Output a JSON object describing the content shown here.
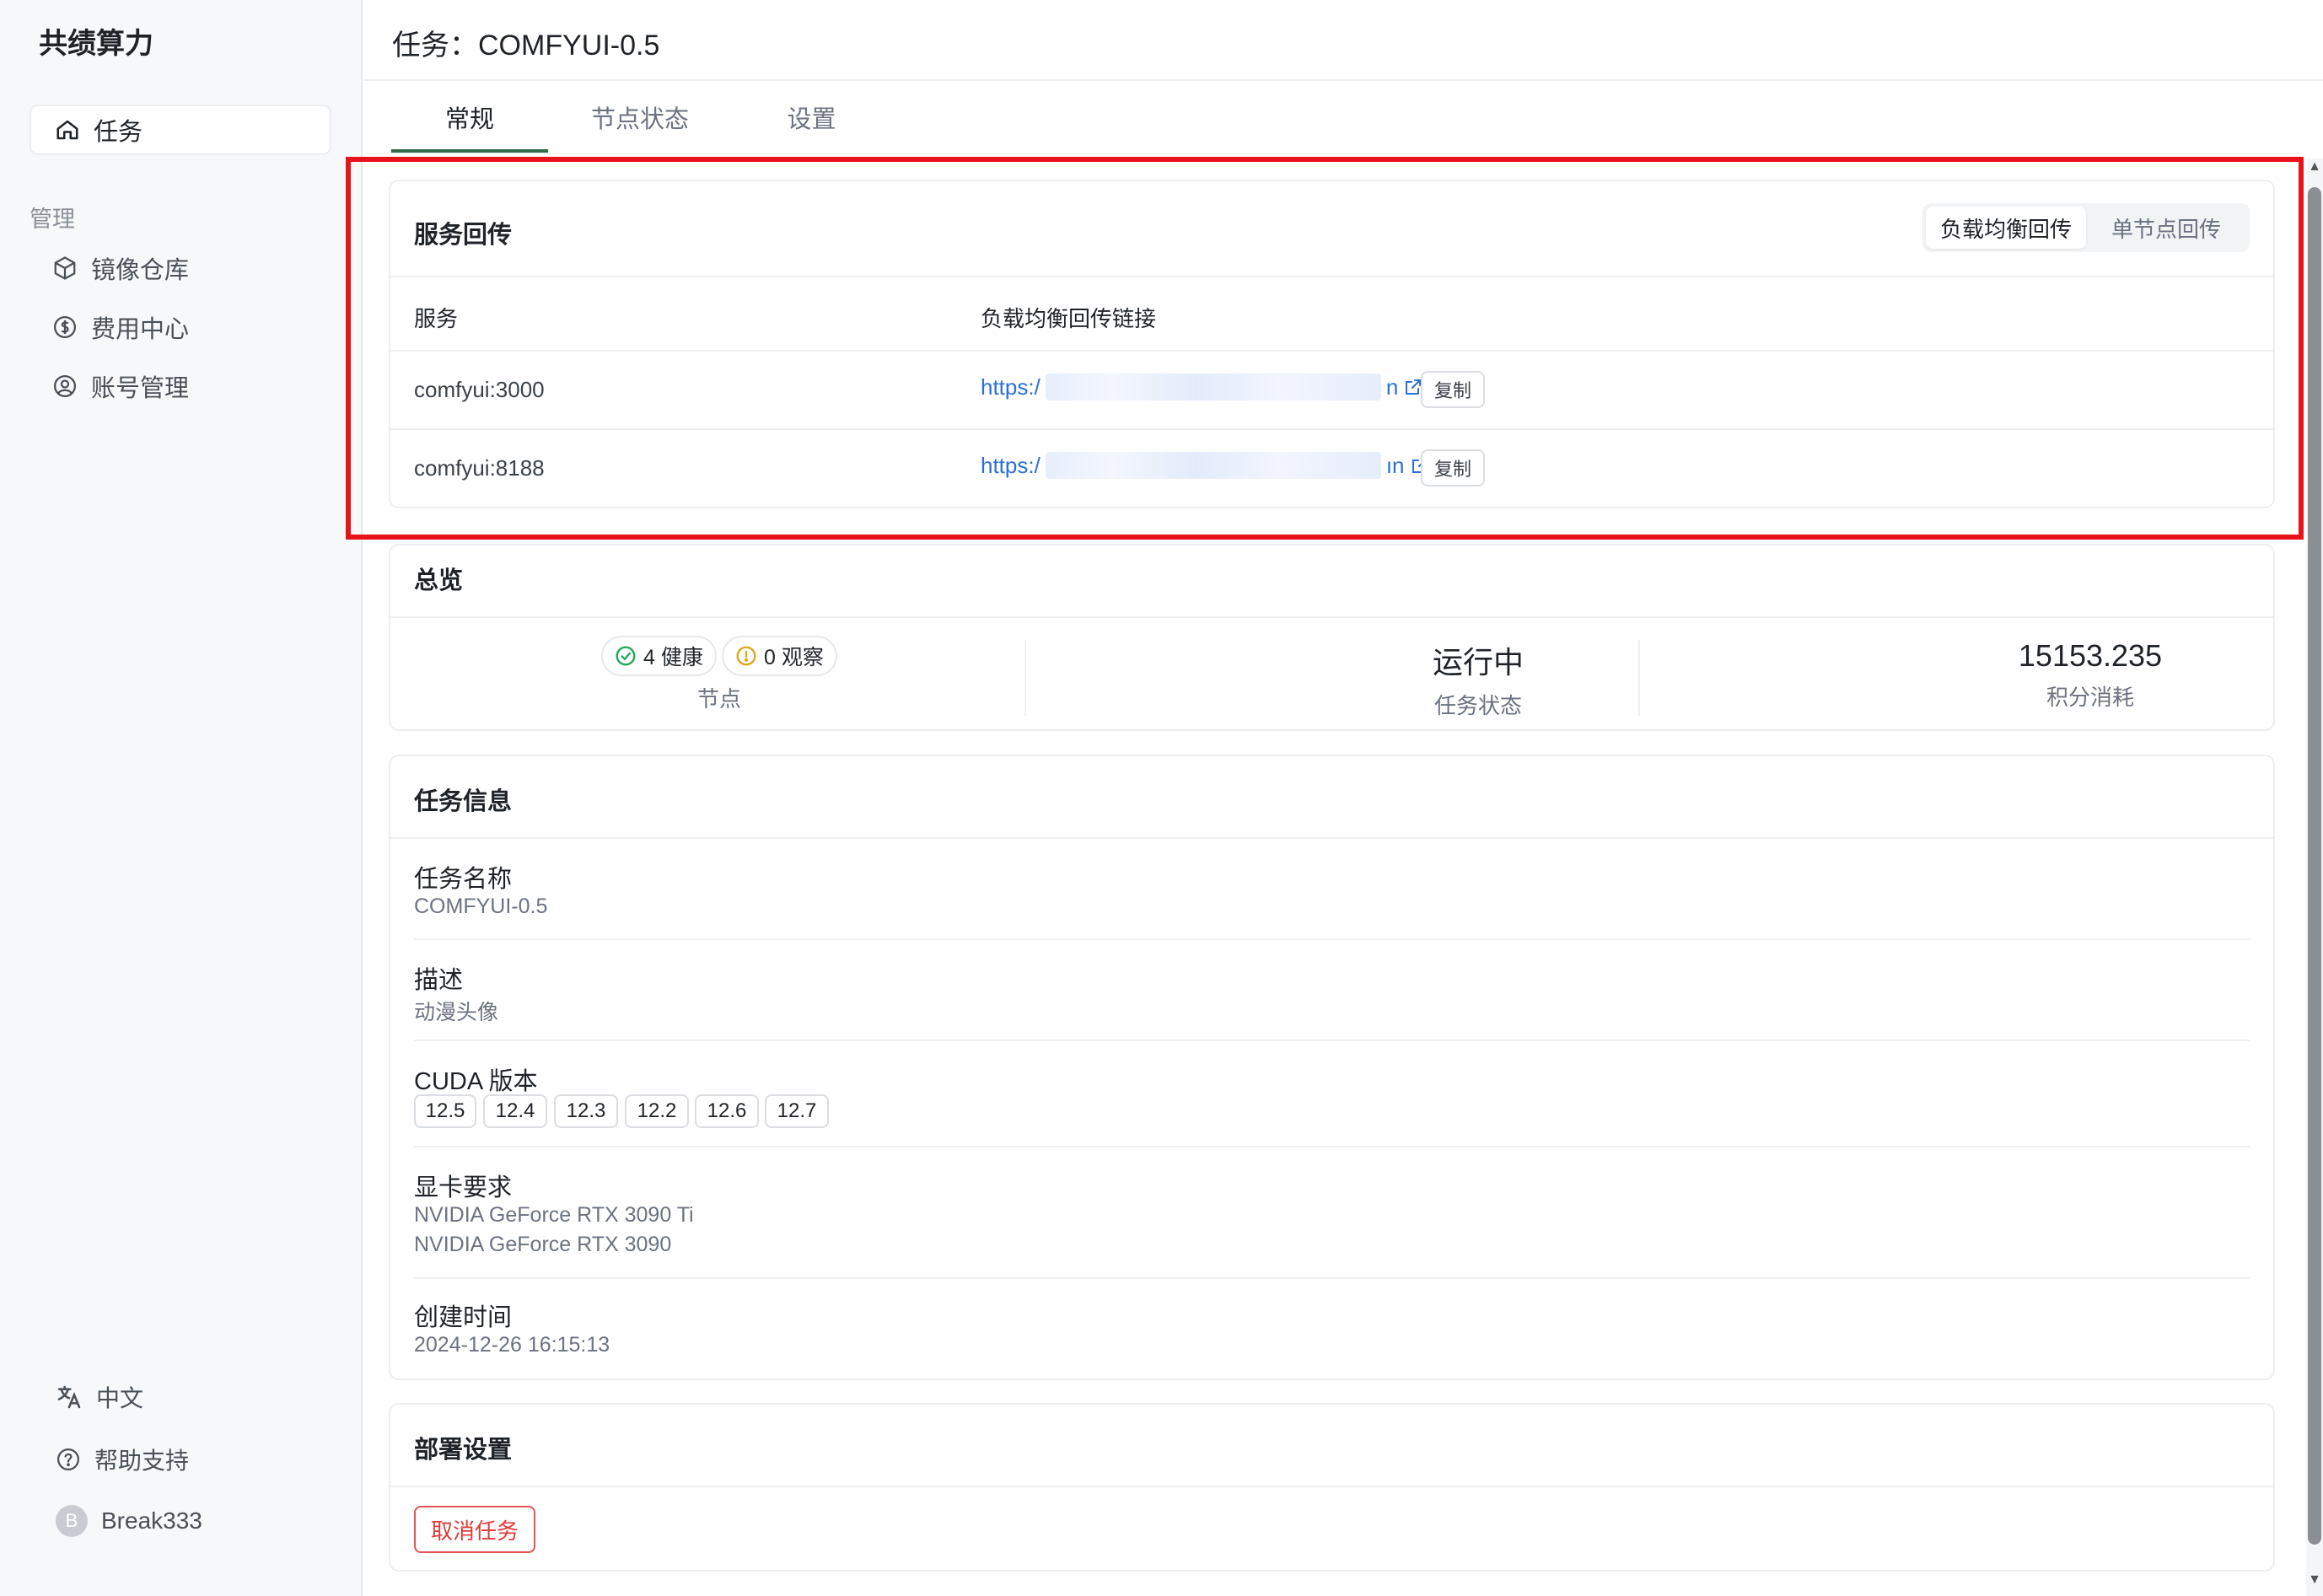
{
  "brand": "共绩算力",
  "sidebar": {
    "active_item": "任务",
    "section_label": "管理",
    "items": [
      {
        "label": "镜像仓库",
        "icon": "cube-icon"
      },
      {
        "label": "费用中心",
        "icon": "dollar-icon"
      },
      {
        "label": "账号管理",
        "icon": "user-circle-icon"
      }
    ],
    "bottom": {
      "language": "中文",
      "help": "帮助支持",
      "user": "Break333",
      "avatar_letter": "B"
    }
  },
  "header": {
    "title": "任务：COMFYUI-0.5",
    "tabs": [
      "常规",
      "节点状态",
      "设置"
    ],
    "active_tab": 0
  },
  "service": {
    "title": "服务回传",
    "toggle": [
      "负载均衡回传",
      "单节点回传"
    ],
    "active_toggle": 0,
    "columns": [
      "服务",
      "负载均衡回传链接"
    ],
    "rows": [
      {
        "service": "comfyui:3000",
        "link_prefix": "https:/",
        "link_suffix": "n",
        "copy": "复制"
      },
      {
        "service": "comfyui:8188",
        "link_prefix": "https:/",
        "link_suffix": "ın",
        "copy": "复制"
      }
    ]
  },
  "overview": {
    "title": "总览",
    "healthy_label": "4 健康",
    "observe_label": "0 观察",
    "nodes_label": "节点",
    "status_value": "运行中",
    "status_label": "任务状态",
    "points_value": "15153.235",
    "points_label": "积分消耗"
  },
  "info": {
    "title": "任务信息",
    "name_label": "任务名称",
    "name_value": "COMFYUI-0.5",
    "desc_label": "描述",
    "desc_value": "动漫头像",
    "cuda_label": "CUDA 版本",
    "cuda_versions": [
      "12.5",
      "12.4",
      "12.3",
      "12.2",
      "12.6",
      "12.7"
    ],
    "gpu_label": "显卡要求",
    "gpus": [
      "NVIDIA GeForce RTX 3090 Ti",
      "NVIDIA GeForce RTX 3090"
    ],
    "created_label": "创建时间",
    "created_value": "2024-12-26 16:15:13"
  },
  "deploy": {
    "title": "部署设置",
    "cancel": "取消任务"
  },
  "colors": {
    "accent": "#2f6b4a",
    "link": "#2b6fd8",
    "highlight": "#e8131a",
    "danger": "#e03b3b",
    "healthy": "#22a85a",
    "observe": "#e0a91a"
  }
}
